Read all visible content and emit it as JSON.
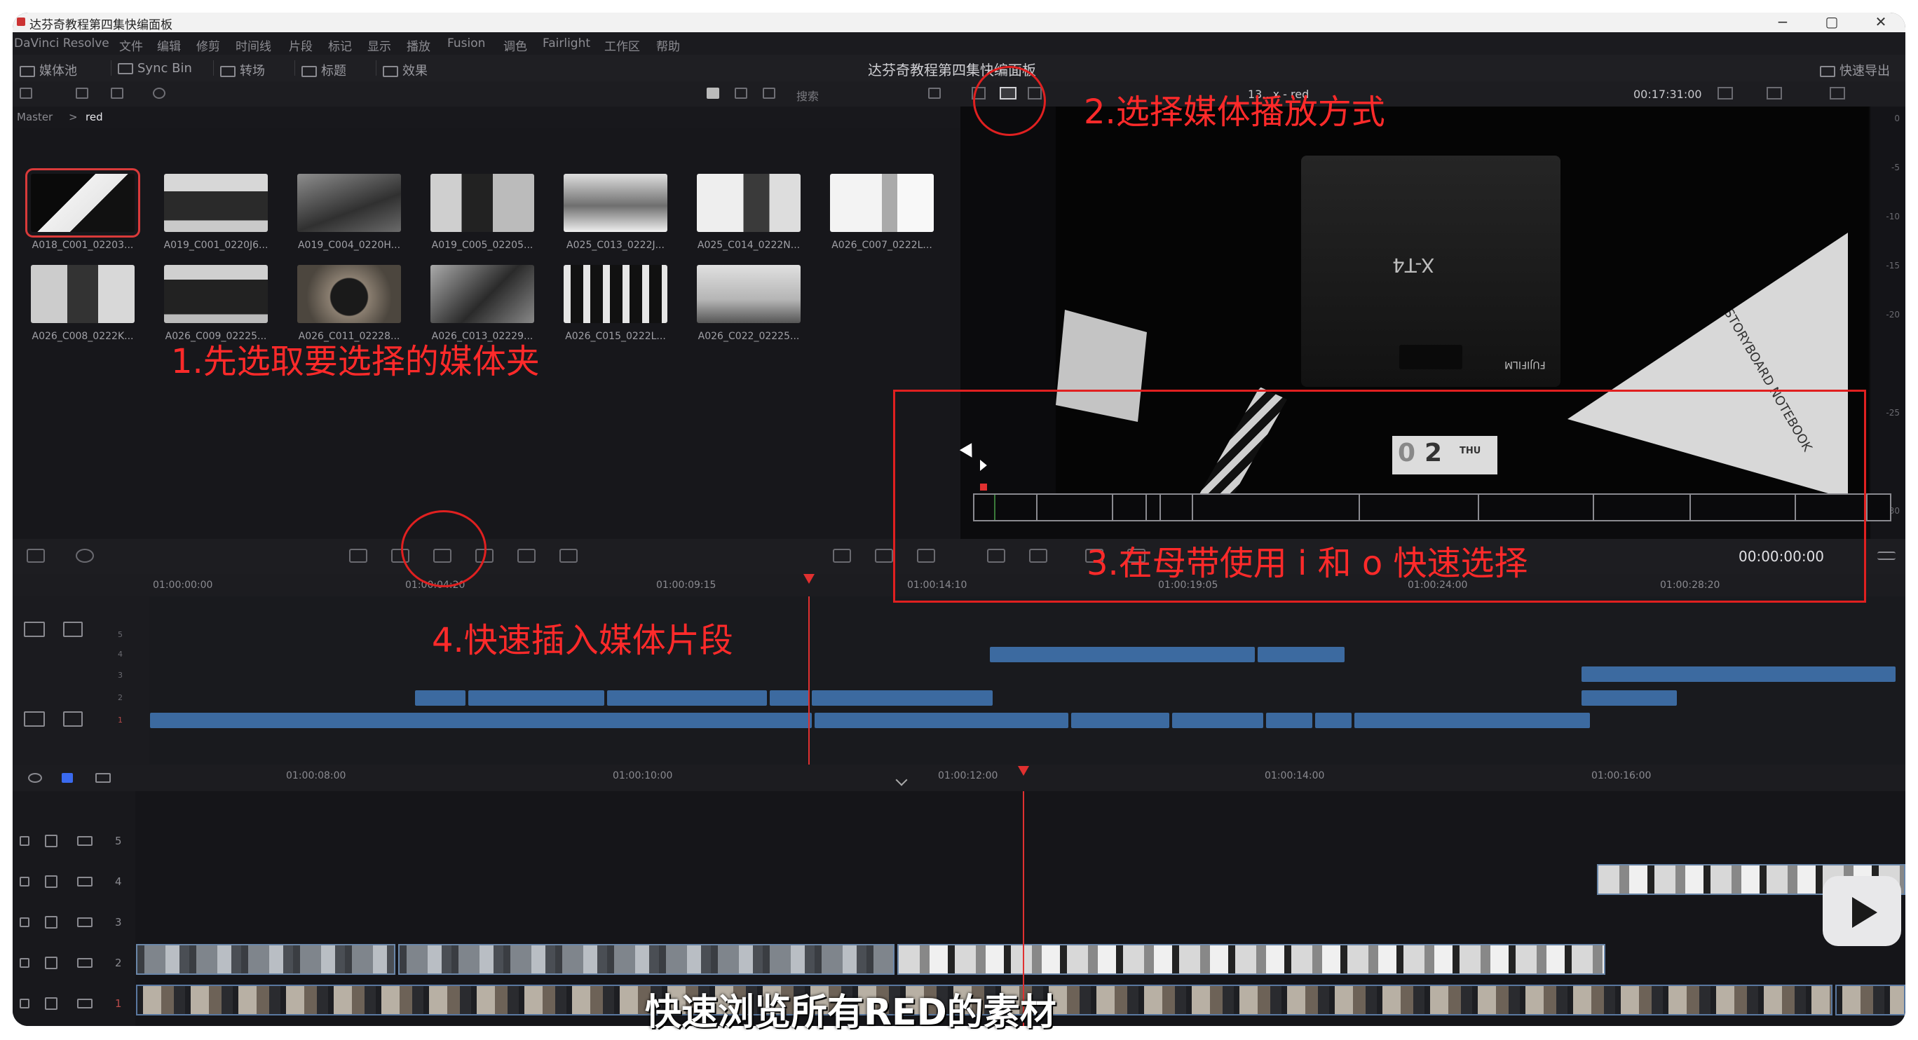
{
  "window": {
    "title": "达芬奇教程第四集快编面板",
    "center_title": "达芬奇教程第四集快编面板",
    "min": "−",
    "max": "▢",
    "close": "✕"
  },
  "menu": [
    "DaVinci Resolve",
    "文件",
    "编辑",
    "修剪",
    "时间线",
    "片段",
    "标记",
    "显示",
    "播放",
    "Fusion",
    "调色",
    "Fairlight",
    "工作区",
    "帮助"
  ],
  "toolbar": {
    "media_pool": "媒体池",
    "sync_bin": "Sync Bin",
    "transitions": "转场",
    "titles": "标题",
    "effects": "效果",
    "quick_export": "快速导出"
  },
  "search": {
    "label": "搜索"
  },
  "breadcrumb": {
    "root": "Master",
    "sep": ">",
    "current": "red"
  },
  "clips": [
    {
      "label": "A018_C001_02203..."
    },
    {
      "label": "A019_C001_0220J6..."
    },
    {
      "label": "A019_C004_0220H..."
    },
    {
      "label": "A019_C005_02205..."
    },
    {
      "label": "A025_C013_0222J..."
    },
    {
      "label": "A025_C014_0222N..."
    },
    {
      "label": "A026_C007_0222L..."
    },
    {
      "label": "A026_C008_0222K..."
    },
    {
      "label": "A026_C009_02225..."
    },
    {
      "label": "A026_C011_02228..."
    },
    {
      "label": "A026_C013_02229..."
    },
    {
      "label": "A026_C015_0222L..."
    },
    {
      "label": "A026_C022_02225..."
    }
  ],
  "viewer": {
    "clip_name": "13...x - red",
    "timecode": "00:17:31:00",
    "playhead_tc": "00:00:00:00",
    "product_text": "X-T4",
    "brand": "FUJIFILM",
    "notebook": "STORYBOARD NOTEBOOK",
    "card_a": "0",
    "card_b": "2",
    "card_c": "THU"
  },
  "viewer_meter": [
    "0",
    "-5",
    "-10",
    "-15",
    "-20",
    "-25",
    "-30"
  ],
  "ruler_top": [
    "01:00:00:00",
    "01:00:04:20",
    "01:00:09:15",
    "01:00:14:10",
    "01:00:19:05",
    "01:00:24:00",
    "01:00:28:20"
  ],
  "ruler_bottom": [
    "01:00:08:00",
    "01:00:10:00",
    "01:00:12:00",
    "01:00:14:00",
    "01:00:16:00"
  ],
  "upper_tracks": [
    "5",
    "4",
    "3",
    "2",
    "1"
  ],
  "lower_tracks": [
    "5",
    "4",
    "3",
    "2",
    "1"
  ],
  "annotations": {
    "a1": "1.先选取要选择的媒体夹",
    "a2": "2.选择媒体播放方式",
    "a3": "3.在母带使用 i 和 o 快速选择",
    "a4": "4.快速插入媒体片段"
  },
  "subtitle": "快速浏览所有RED的素材",
  "colors": {
    "accent_red": "#e02020",
    "clip_blue": "#3c6aa0",
    "bg_dark": "#16161a"
  }
}
